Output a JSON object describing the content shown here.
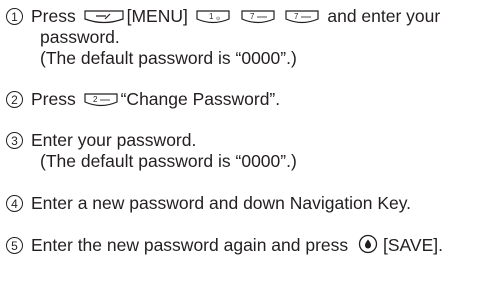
{
  "steps": [
    {
      "number": "1",
      "before": "Press",
      "menu_label": "[MENU]",
      "after": "and enter your",
      "cont1": "password.",
      "cont2": "(The default password is “0000”.)",
      "keys": {
        "menu": "menu-key-icon",
        "k1": "1",
        "k7a": "7",
        "k7b": "7"
      }
    },
    {
      "number": "2",
      "before": "Press",
      "after": "“Change Password”.",
      "keys": {
        "k2": "2"
      }
    },
    {
      "number": "3",
      "text": "Enter your password.",
      "cont": "(The default password is “0000”.)"
    },
    {
      "number": "4",
      "text": "Enter a new password and down Navigation Key."
    },
    {
      "number": "5",
      "before": "Enter the new password again and press",
      "after": "[SAVE].",
      "icon": "ok-key-icon"
    }
  ]
}
